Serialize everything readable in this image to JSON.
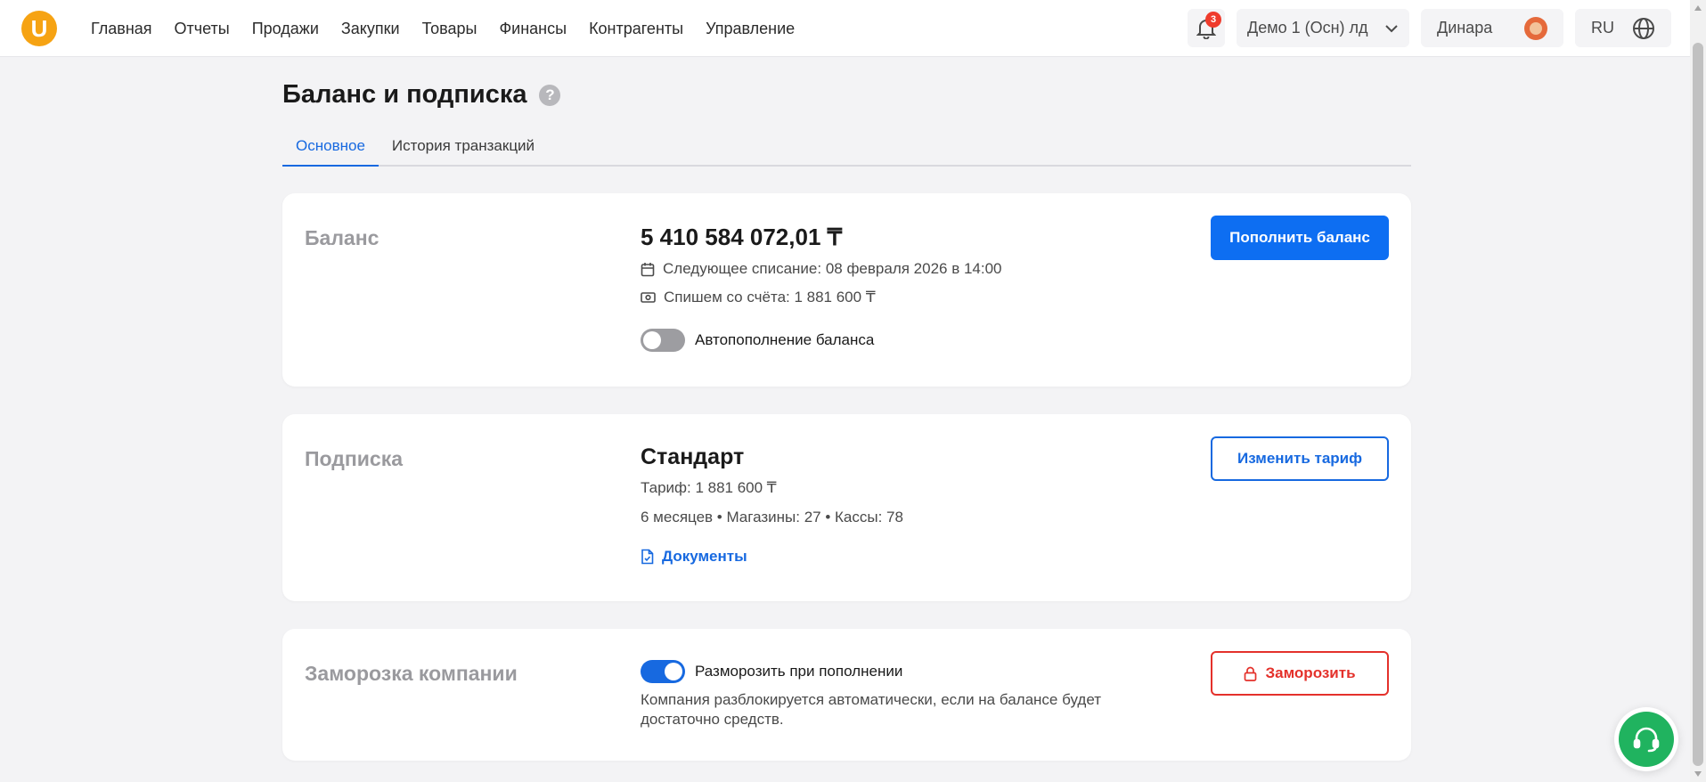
{
  "header": {
    "logo_letter": "U",
    "nav": [
      "Главная",
      "Отчеты",
      "Продажи",
      "Закупки",
      "Товары",
      "Финансы",
      "Контрагенты",
      "Управление"
    ],
    "notifications_count": "3",
    "organization": "Демо 1 (Осн) лд",
    "user_name": "Динара",
    "language": "RU"
  },
  "page": {
    "title": "Баланс и подписка",
    "tabs": [
      {
        "label": "Основное",
        "active": true
      },
      {
        "label": "История транзакций",
        "active": false
      }
    ]
  },
  "balance": {
    "section_title": "Баланс",
    "amount": "5 410 584 072,01 ₸",
    "next_charge": "Следующее списание: 08 февраля 2026 в 14:00",
    "charge_amount": "Спишем со счёта: 1 881 600 ₸",
    "autotopup_label": "Автопополнение баланса",
    "autotopup_enabled": false,
    "topup_button": "Пополнить баланс"
  },
  "subscription": {
    "section_title": "Подписка",
    "plan_name": "Стандарт",
    "tariff": "Тариф: 1 881 600 ₸",
    "details": "6 месяцев • Магазины: 27 • Кассы: 78",
    "documents_link": "Документы",
    "change_button": "Изменить тариф"
  },
  "freeze": {
    "section_title": "Заморозка компании",
    "unfreeze_label": "Разморозить при пополнении",
    "unfreeze_enabled": true,
    "description": "Компания разблокируется автоматически, если на балансе будет достаточно средств.",
    "freeze_button": "Заморозить"
  },
  "colors": {
    "accent": "#0d6ef2",
    "danger": "#e4312b",
    "logo": "#f6a313",
    "support": "#20b35f"
  }
}
